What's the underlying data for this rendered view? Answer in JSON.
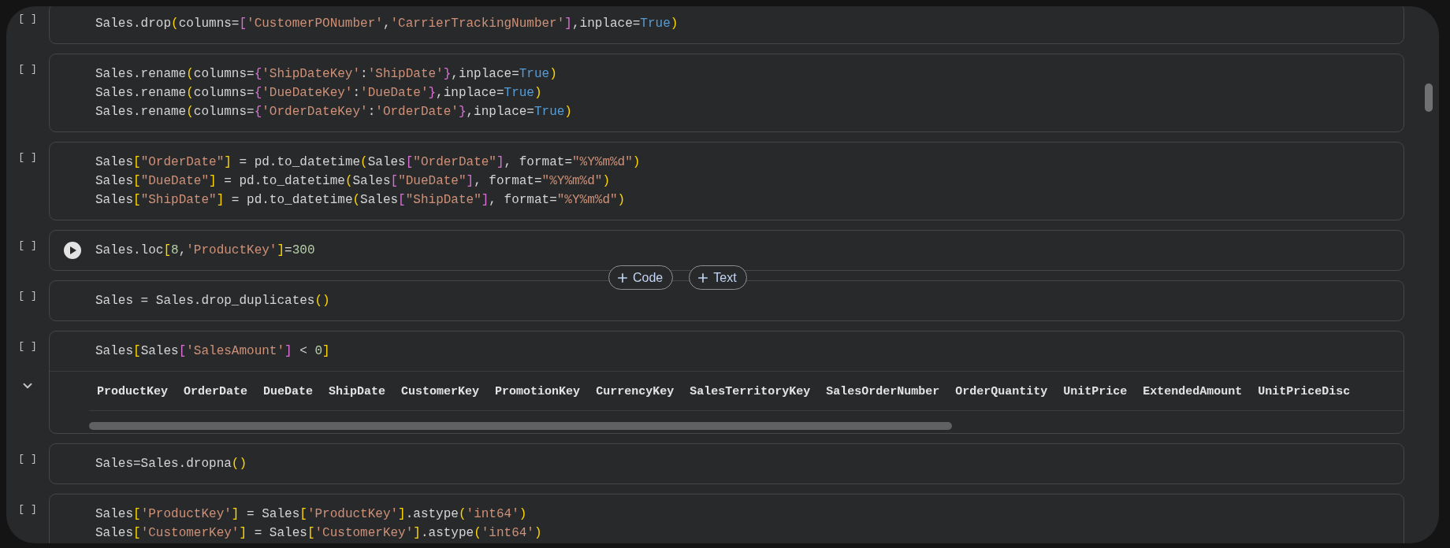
{
  "cells": [
    {
      "execution": "[ ]",
      "run_button": false,
      "lines": [
        [
          {
            "t": "Sales.drop",
            "kind": "plain"
          },
          {
            "t": "(",
            "kind": "b1"
          },
          {
            "t": "columns=",
            "kind": "plain"
          },
          {
            "t": "[",
            "kind": "b2"
          },
          {
            "t": "'CustomerPONumber'",
            "kind": "string"
          },
          {
            "t": ",",
            "kind": "plain"
          },
          {
            "t": "'CarrierTrackingNumber'",
            "kind": "string"
          },
          {
            "t": "]",
            "kind": "b2"
          },
          {
            "t": ",inplace=",
            "kind": "plain"
          },
          {
            "t": "True",
            "kind": "keyword"
          },
          {
            "t": ")",
            "kind": "b1"
          }
        ]
      ]
    },
    {
      "execution": "[ ]",
      "run_button": false,
      "lines": [
        [
          {
            "t": "Sales.rename",
            "kind": "plain"
          },
          {
            "t": "(",
            "kind": "b1"
          },
          {
            "t": "columns=",
            "kind": "plain"
          },
          {
            "t": "{",
            "kind": "b2"
          },
          {
            "t": "'ShipDateKey'",
            "kind": "string"
          },
          {
            "t": ":",
            "kind": "plain"
          },
          {
            "t": "'ShipDate'",
            "kind": "string"
          },
          {
            "t": "}",
            "kind": "b2"
          },
          {
            "t": ",inplace=",
            "kind": "plain"
          },
          {
            "t": "True",
            "kind": "keyword"
          },
          {
            "t": ")",
            "kind": "b1"
          }
        ],
        [
          {
            "t": "Sales.rename",
            "kind": "plain"
          },
          {
            "t": "(",
            "kind": "b1"
          },
          {
            "t": "columns=",
            "kind": "plain"
          },
          {
            "t": "{",
            "kind": "b2"
          },
          {
            "t": "'DueDateKey'",
            "kind": "string"
          },
          {
            "t": ":",
            "kind": "plain"
          },
          {
            "t": "'DueDate'",
            "kind": "string"
          },
          {
            "t": "}",
            "kind": "b2"
          },
          {
            "t": ",inplace=",
            "kind": "plain"
          },
          {
            "t": "True",
            "kind": "keyword"
          },
          {
            "t": ")",
            "kind": "b1"
          }
        ],
        [
          {
            "t": "Sales.rename",
            "kind": "plain"
          },
          {
            "t": "(",
            "kind": "b1"
          },
          {
            "t": "columns=",
            "kind": "plain"
          },
          {
            "t": "{",
            "kind": "b2"
          },
          {
            "t": "'OrderDateKey'",
            "kind": "string"
          },
          {
            "t": ":",
            "kind": "plain"
          },
          {
            "t": "'OrderDate'",
            "kind": "string"
          },
          {
            "t": "}",
            "kind": "b2"
          },
          {
            "t": ",inplace=",
            "kind": "plain"
          },
          {
            "t": "True",
            "kind": "keyword"
          },
          {
            "t": ")",
            "kind": "b1"
          }
        ]
      ]
    },
    {
      "execution": "[ ]",
      "run_button": false,
      "lines": [
        [
          {
            "t": "Sales",
            "kind": "plain"
          },
          {
            "t": "[",
            "kind": "b1"
          },
          {
            "t": "\"OrderDate\"",
            "kind": "string"
          },
          {
            "t": "]",
            "kind": "b1"
          },
          {
            "t": " = pd.to_datetime",
            "kind": "plain"
          },
          {
            "t": "(",
            "kind": "b1"
          },
          {
            "t": "Sales",
            "kind": "plain"
          },
          {
            "t": "[",
            "kind": "b2"
          },
          {
            "t": "\"OrderDate\"",
            "kind": "string"
          },
          {
            "t": "]",
            "kind": "b2"
          },
          {
            "t": ", format=",
            "kind": "plain"
          },
          {
            "t": "\"%Y%m%d\"",
            "kind": "string"
          },
          {
            "t": ")",
            "kind": "b1"
          }
        ],
        [
          {
            "t": "Sales",
            "kind": "plain"
          },
          {
            "t": "[",
            "kind": "b1"
          },
          {
            "t": "\"DueDate\"",
            "kind": "string"
          },
          {
            "t": "]",
            "kind": "b1"
          },
          {
            "t": " = pd.to_datetime",
            "kind": "plain"
          },
          {
            "t": "(",
            "kind": "b1"
          },
          {
            "t": "Sales",
            "kind": "plain"
          },
          {
            "t": "[",
            "kind": "b2"
          },
          {
            "t": "\"DueDate\"",
            "kind": "string"
          },
          {
            "t": "]",
            "kind": "b2"
          },
          {
            "t": ", format=",
            "kind": "plain"
          },
          {
            "t": "\"%Y%m%d\"",
            "kind": "string"
          },
          {
            "t": ")",
            "kind": "b1"
          }
        ],
        [
          {
            "t": "Sales",
            "kind": "plain"
          },
          {
            "t": "[",
            "kind": "b1"
          },
          {
            "t": "\"ShipDate\"",
            "kind": "string"
          },
          {
            "t": "]",
            "kind": "b1"
          },
          {
            "t": " = pd.to_datetime",
            "kind": "plain"
          },
          {
            "t": "(",
            "kind": "b1"
          },
          {
            "t": "Sales",
            "kind": "plain"
          },
          {
            "t": "[",
            "kind": "b2"
          },
          {
            "t": "\"ShipDate\"",
            "kind": "string"
          },
          {
            "t": "]",
            "kind": "b2"
          },
          {
            "t": ", format=",
            "kind": "plain"
          },
          {
            "t": "\"%Y%m%d\"",
            "kind": "string"
          },
          {
            "t": ")",
            "kind": "b1"
          }
        ]
      ]
    },
    {
      "execution": "[ ]",
      "run_button": true,
      "lines": [
        [
          {
            "t": "Sales.loc",
            "kind": "plain"
          },
          {
            "t": "[",
            "kind": "b1"
          },
          {
            "t": "8",
            "kind": "number"
          },
          {
            "t": ",",
            "kind": "plain"
          },
          {
            "t": "'ProductKey'",
            "kind": "string"
          },
          {
            "t": "]",
            "kind": "b1"
          },
          {
            "t": "=",
            "kind": "plain"
          },
          {
            "t": "300",
            "kind": "number"
          }
        ]
      ],
      "insert_buttons": [
        {
          "label": "Code"
        },
        {
          "label": "Text"
        }
      ]
    },
    {
      "execution": "[ ]",
      "run_button": false,
      "lines": [
        [
          {
            "t": "Sales = Sales.drop_duplicates",
            "kind": "plain"
          },
          {
            "t": "()",
            "kind": "b1"
          }
        ]
      ]
    },
    {
      "execution": "[ ]",
      "run_button": false,
      "lines": [
        [
          {
            "t": "Sales",
            "kind": "plain"
          },
          {
            "t": "[",
            "kind": "b1"
          },
          {
            "t": "Sales",
            "kind": "plain"
          },
          {
            "t": "[",
            "kind": "b2"
          },
          {
            "t": "'SalesAmount'",
            "kind": "string"
          },
          {
            "t": "]",
            "kind": "b2"
          },
          {
            "t": " < ",
            "kind": "plain"
          },
          {
            "t": "0",
            "kind": "number"
          },
          {
            "t": "]",
            "kind": "b1"
          }
        ]
      ],
      "output": {
        "expanded": true,
        "columns": [
          "ProductKey",
          "OrderDate",
          "DueDate",
          "ShipDate",
          "CustomerKey",
          "PromotionKey",
          "CurrencyKey",
          "SalesTerritoryKey",
          "SalesOrderNumber",
          "OrderQuantity",
          "UnitPrice",
          "ExtendedAmount",
          "UnitPriceDisc"
        ]
      }
    },
    {
      "execution": "[ ]",
      "run_button": false,
      "lines": [
        [
          {
            "t": "Sales=Sales.dropna",
            "kind": "plain"
          },
          {
            "t": "()",
            "kind": "b1"
          }
        ]
      ]
    },
    {
      "execution": "[ ]",
      "run_button": false,
      "lines": [
        [
          {
            "t": "Sales",
            "kind": "plain"
          },
          {
            "t": "[",
            "kind": "b1"
          },
          {
            "t": "'ProductKey'",
            "kind": "string"
          },
          {
            "t": "]",
            "kind": "b1"
          },
          {
            "t": " = Sales",
            "kind": "plain"
          },
          {
            "t": "[",
            "kind": "b1"
          },
          {
            "t": "'ProductKey'",
            "kind": "string"
          },
          {
            "t": "]",
            "kind": "b1"
          },
          {
            "t": ".astype",
            "kind": "plain"
          },
          {
            "t": "(",
            "kind": "b1"
          },
          {
            "t": "'int64'",
            "kind": "string"
          },
          {
            "t": ")",
            "kind": "b1"
          }
        ],
        [
          {
            "t": "Sales",
            "kind": "plain"
          },
          {
            "t": "[",
            "kind": "b1"
          },
          {
            "t": "'CustomerKey'",
            "kind": "string"
          },
          {
            "t": "]",
            "kind": "b1"
          },
          {
            "t": " = Sales",
            "kind": "plain"
          },
          {
            "t": "[",
            "kind": "b1"
          },
          {
            "t": "'CustomerKey'",
            "kind": "string"
          },
          {
            "t": "]",
            "kind": "b1"
          },
          {
            "t": ".astype",
            "kind": "plain"
          },
          {
            "t": "(",
            "kind": "b1"
          },
          {
            "t": "'int64'",
            "kind": "string"
          },
          {
            "t": ")",
            "kind": "b1"
          }
        ]
      ]
    }
  ]
}
